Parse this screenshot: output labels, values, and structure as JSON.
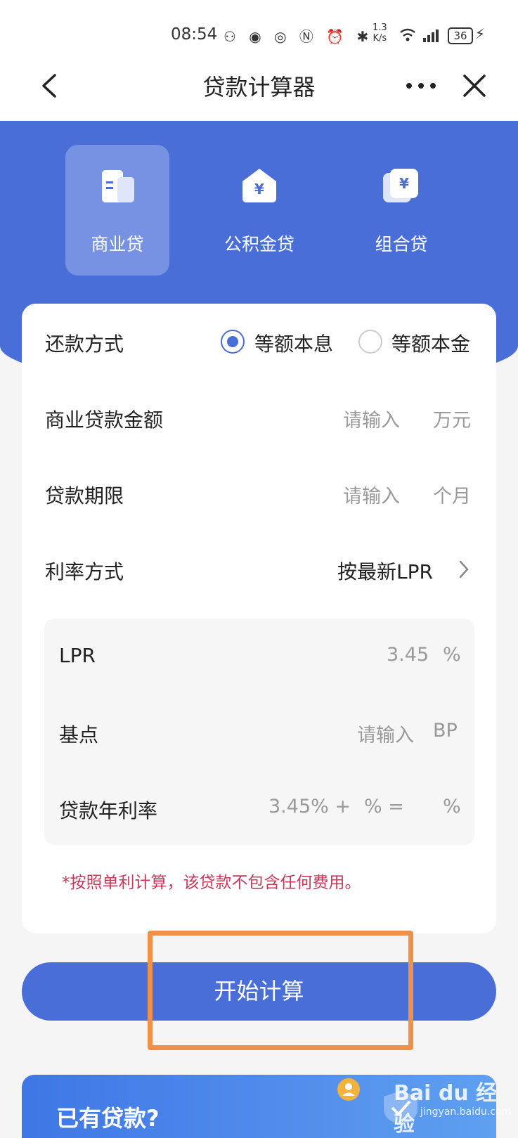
{
  "status": {
    "time": "08:54",
    "speed_value": "1.3",
    "speed_unit": "K/s",
    "battery": "36"
  },
  "nav": {
    "title": "贷款计算器"
  },
  "tabs": [
    {
      "label": "商业贷",
      "active": true
    },
    {
      "label": "公积金贷",
      "active": false
    },
    {
      "label": "组合贷",
      "active": false
    }
  ],
  "form": {
    "repay": {
      "label": "还款方式",
      "options": [
        "等额本息",
        "等额本金"
      ],
      "selected": "等额本息"
    },
    "amount": {
      "label": "商业贷款金额",
      "placeholder": "请输入",
      "unit": "万元"
    },
    "term": {
      "label": "贷款期限",
      "placeholder": "请输入",
      "unit": "个月"
    },
    "rate_method": {
      "label": "利率方式",
      "value": "按最新LPR"
    },
    "lpr": {
      "label": "LPR",
      "value": "3.45",
      "unit": "%"
    },
    "bp": {
      "label": "基点",
      "placeholder": "请输入",
      "unit": "BP"
    },
    "annual": {
      "label": "贷款年利率",
      "formula_base": "3.45% +",
      "formula_mid": "% =",
      "unit": "%"
    },
    "note": "*按照单利计算，该贷款不包含任何费用。"
  },
  "calc_button": "开始计算",
  "banner": {
    "title": "已有贷款?"
  },
  "watermark": {
    "brand": "Bai du 经验",
    "url": "jingyan.baidu.com"
  },
  "colors": {
    "primary": "#4a6ed8",
    "highlight": "#f0914a",
    "note": "#c83a5a"
  }
}
